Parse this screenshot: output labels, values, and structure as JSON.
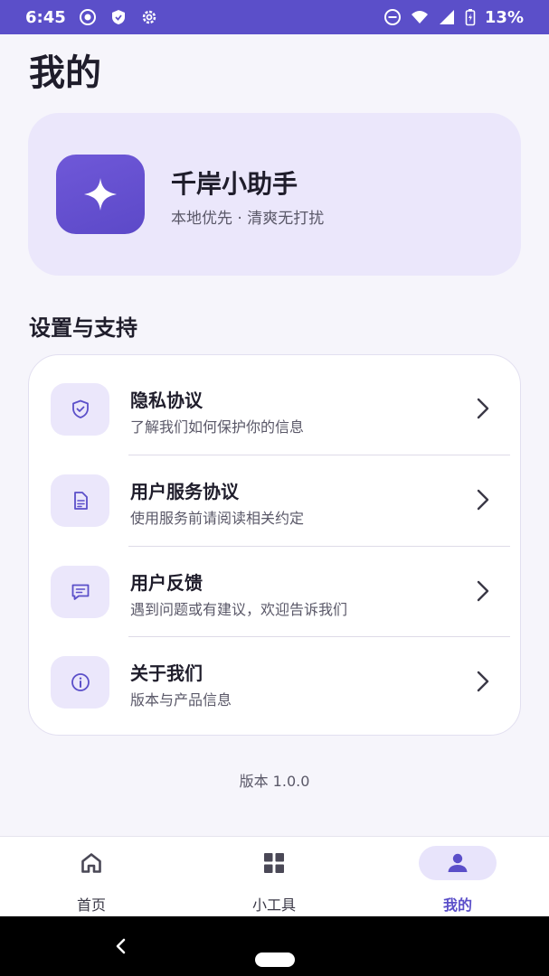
{
  "status_bar": {
    "time": "6:45",
    "battery": "13%",
    "icons": [
      "record-icon",
      "shield-icon",
      "gear-icon",
      "dnd-icon",
      "wifi-icon",
      "signal-icon",
      "battery-icon"
    ]
  },
  "page": {
    "title": "我的"
  },
  "profile": {
    "app_name": "千岸小助手",
    "slogan": "本地优先 · 清爽无打扰",
    "icon": "sparkle-icon"
  },
  "settings": {
    "section_title": "设置与支持",
    "items": [
      {
        "title": "隐私协议",
        "desc": "了解我们如何保护你的信息",
        "icon": "shield-check-icon"
      },
      {
        "title": "用户服务协议",
        "desc": "使用服务前请阅读相关约定",
        "icon": "document-icon"
      },
      {
        "title": "用户反馈",
        "desc": "遇到问题或有建议，欢迎告诉我们",
        "icon": "chat-icon"
      },
      {
        "title": "关于我们",
        "desc": "版本与产品信息",
        "icon": "info-icon"
      }
    ]
  },
  "version": "版本 1.0.0",
  "bottom_nav": {
    "items": [
      {
        "label": "首页",
        "icon": "home-icon",
        "active": false
      },
      {
        "label": "小工具",
        "icon": "grid-icon",
        "active": false
      },
      {
        "label": "我的",
        "icon": "person-icon",
        "active": true
      }
    ]
  },
  "colors": {
    "accent": "#5b4fc9",
    "card_bg": "#ebe7fb",
    "background": "#f6f5fb"
  }
}
